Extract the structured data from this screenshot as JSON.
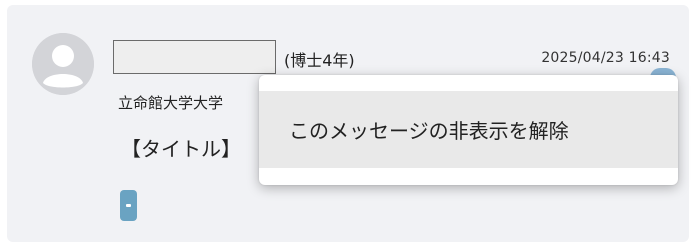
{
  "message": {
    "grade": "(博士4年)",
    "date": "2025/04/23 16:43",
    "affiliation": "立命館大学大学",
    "title": "【タイトル】"
  },
  "context_menu": {
    "items": [
      {
        "label": "このメッセージの非表示を解除"
      }
    ]
  },
  "colors": {
    "card_background": "#f1f2f5",
    "avatar_placeholder": "#d3d4d8",
    "tag_color": "#6aa3c2",
    "menu_highlight": "#e9e9e9"
  },
  "icons": {
    "avatar": "user-silhouette-icon"
  }
}
